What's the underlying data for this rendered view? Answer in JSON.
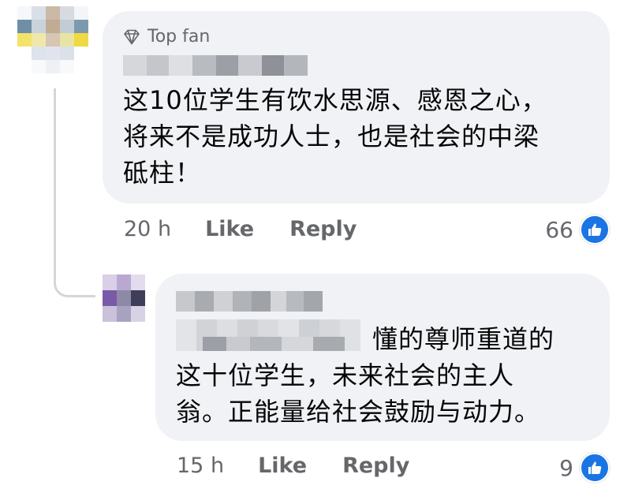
{
  "comment1": {
    "badge": "Top fan",
    "body": "这10位学生有饮水思源、感恩之心，\n将来不是成功人士，也是社会的中梁\n砥柱！",
    "time": "20 h",
    "like_label": "Like",
    "reply_label": "Reply",
    "reaction_count": "66"
  },
  "reply1": {
    "body_line1": "懂的尊师重道的",
    "body_line2": "这十位学生，未来社会的主人",
    "body_line3": "翁。正能量给社会鼓励与动力。",
    "time": "15 h",
    "like_label": "Like",
    "reply_label": "Reply",
    "reaction_count": "9"
  },
  "colors": {
    "bubble": "#f0f2f5",
    "secondary_text": "#65676b",
    "like_blue": "#1b74e4"
  },
  "icons": [
    "diamond-icon",
    "thumbs-up-icon"
  ]
}
